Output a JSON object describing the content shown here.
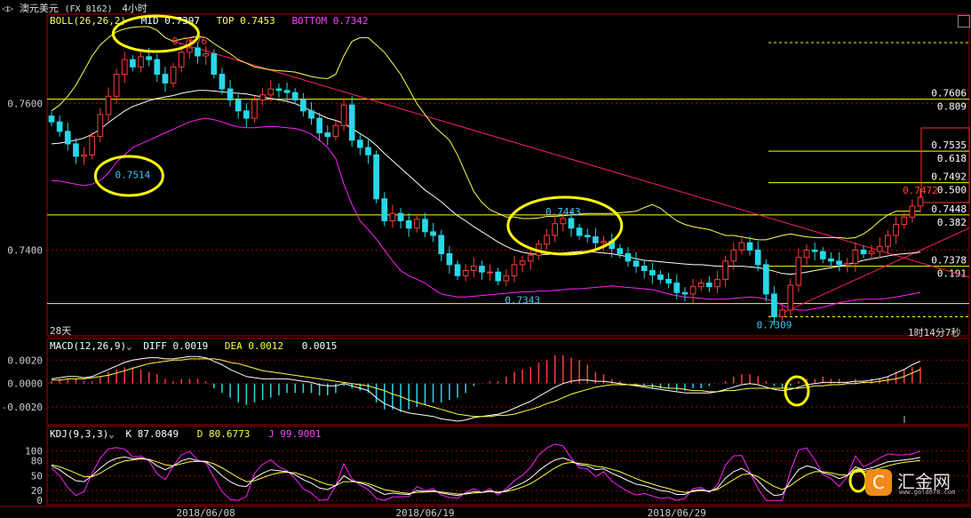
{
  "window": {
    "symbol_label": "澳元美元",
    "code_label": "(FX 8162)",
    "period_label": "4小时"
  },
  "boll": {
    "label": "BOLL(26,26,2)",
    "mid": "MID 0.7397",
    "top": "TOP 0.7453",
    "bottom": "BOTTOM 0.7342"
  },
  "macd": {
    "label": "MACD(12,26,9)",
    "diff": "DIFF 0.0019",
    "dea": "DEA 0.0012",
    "macd": "0.0015"
  },
  "kdj": {
    "label": "KDJ(9,3,3)",
    "k": "K 87.0849",
    "d": "D 80.6773",
    "j": "J 99.9001"
  },
  "footer": {
    "period_note": "28天",
    "countdown": "1时14分7秒"
  },
  "colors": {
    "up": "#ff3c3c",
    "down": "#28d8e8",
    "boll_mid": "#ffffff",
    "boll_top": "#ffff50",
    "boll_bottom": "#ff20ff",
    "fib": "#ffff00",
    "trend": "#ff2060",
    "dif": "#ffffff",
    "dea": "#ffff40",
    "k": "#ffffff",
    "d": "#ffff40",
    "j": "#ff20ff"
  },
  "chart_data": [
    {
      "type": "candlestick",
      "panel": "price",
      "ylim": [
        0.7295,
        0.7705
      ],
      "y_ticks": [
        "0.7600",
        "0.7400"
      ],
      "x_ticks": [
        "2018/06/08",
        "2018/06/19",
        "2018/06/29"
      ],
      "close": [
        0.7575,
        0.7562,
        0.7545,
        0.7528,
        0.753,
        0.7555,
        0.7585,
        0.761,
        0.764,
        0.766,
        0.765,
        0.7664,
        0.766,
        0.764,
        0.7628,
        0.765,
        0.767,
        0.7676,
        0.7665,
        0.7668,
        0.764,
        0.762,
        0.7605,
        0.759,
        0.758,
        0.7605,
        0.7612,
        0.762,
        0.7618,
        0.7615,
        0.7605,
        0.759,
        0.758,
        0.756,
        0.7555,
        0.757,
        0.7598,
        0.755,
        0.754,
        0.753,
        0.747,
        0.744,
        0.745,
        0.744,
        0.743,
        0.7442,
        0.7425,
        0.742,
        0.7395,
        0.738,
        0.7365,
        0.7372,
        0.7378,
        0.737,
        0.737,
        0.7358,
        0.7365,
        0.738,
        0.7385,
        0.7393,
        0.7408,
        0.742,
        0.7436,
        0.7443,
        0.743,
        0.742,
        0.7418,
        0.741,
        0.7412,
        0.7402,
        0.7395,
        0.7385,
        0.7378,
        0.7372,
        0.7366,
        0.736,
        0.7355,
        0.7342,
        0.734,
        0.735,
        0.7355,
        0.735,
        0.736,
        0.7385,
        0.74,
        0.741,
        0.74,
        0.738,
        0.734,
        0.7309,
        0.7318,
        0.7352,
        0.739,
        0.74,
        0.7398,
        0.7388,
        0.7385,
        0.738,
        0.7382,
        0.74,
        0.7395,
        0.7398,
        0.7405,
        0.742,
        0.7435,
        0.7445,
        0.746,
        0.7472
      ],
      "mid": [
        0.7545,
        0.7546,
        0.7548,
        0.755,
        0.7553,
        0.7558,
        0.7565,
        0.7574,
        0.7582,
        0.759,
        0.7596,
        0.76,
        0.7604,
        0.7607,
        0.7609,
        0.7611,
        0.7614,
        0.7616,
        0.7618,
        0.7618,
        0.7617,
        0.7616,
        0.7615,
        0.7614,
        0.7613,
        0.7611,
        0.7609,
        0.7607,
        0.7605,
        0.7603,
        0.76,
        0.7595,
        0.759,
        0.7585,
        0.758,
        0.7577,
        0.7573,
        0.7566,
        0.7559,
        0.7552,
        0.7543,
        0.7532,
        0.7522,
        0.7512,
        0.7502,
        0.7492,
        0.7482,
        0.7474,
        0.7466,
        0.7456,
        0.7447,
        0.744,
        0.7432,
        0.7425,
        0.7418,
        0.7411,
        0.7405,
        0.74,
        0.7397,
        0.7395,
        0.7394,
        0.7394,
        0.7395,
        0.7396,
        0.7397,
        0.7398,
        0.7398,
        0.7397,
        0.7396,
        0.7395,
        0.7393,
        0.7391,
        0.7388,
        0.7386,
        0.7385,
        0.7384,
        0.7383,
        0.7382,
        0.7381,
        0.738,
        0.738,
        0.7379,
        0.7378,
        0.7378,
        0.7378,
        0.7378,
        0.7377,
        0.7376,
        0.7374,
        0.7371,
        0.7368,
        0.7367,
        0.7368,
        0.737,
        0.7372,
        0.7374,
        0.7376,
        0.7378,
        0.738,
        0.7383,
        0.7386,
        0.7388,
        0.739,
        0.7392,
        0.7394,
        0.7395,
        0.7396,
        0.7397
      ],
      "top": [
        0.759,
        0.7598,
        0.761,
        0.7625,
        0.7645,
        0.7665,
        0.768,
        0.769,
        0.7698,
        0.7702,
        0.7704,
        0.7705,
        0.7705,
        0.77,
        0.769,
        0.7685,
        0.7688,
        0.769,
        0.7692,
        0.769,
        0.7682,
        0.7675,
        0.7668,
        0.766,
        0.7655,
        0.765,
        0.7648,
        0.7646,
        0.7645,
        0.7644,
        0.7643,
        0.764,
        0.7637,
        0.7635,
        0.7634,
        0.764,
        0.7665,
        0.7685,
        0.769,
        0.769,
        0.768,
        0.767,
        0.7655,
        0.764,
        0.762,
        0.76,
        0.7585,
        0.757,
        0.756,
        0.755,
        0.753,
        0.7505,
        0.748,
        0.7465,
        0.7455,
        0.745,
        0.7445,
        0.7445,
        0.7443,
        0.7443,
        0.7444,
        0.7446,
        0.7446,
        0.7447,
        0.7448,
        0.7449,
        0.745,
        0.745,
        0.745,
        0.745,
        0.7451,
        0.7452,
        0.7453,
        0.7458,
        0.7462,
        0.7457,
        0.7448,
        0.744,
        0.7435,
        0.7432,
        0.743,
        0.7428,
        0.7424,
        0.742,
        0.742,
        0.7418,
        0.7416,
        0.7414,
        0.7414,
        0.7417,
        0.742,
        0.7422,
        0.742,
        0.7418,
        0.7417,
        0.7417,
        0.7417,
        0.7417,
        0.7416,
        0.7417,
        0.7422,
        0.743,
        0.744,
        0.7448,
        0.7453,
        0.7453,
        0.7453,
        0.7453
      ],
      "bottom": [
        0.7495,
        0.7494,
        0.7492,
        0.749,
        0.7488,
        0.749,
        0.7495,
        0.7505,
        0.752,
        0.753,
        0.754,
        0.7545,
        0.755,
        0.7555,
        0.756,
        0.7565,
        0.757,
        0.7575,
        0.7578,
        0.758,
        0.7578,
        0.7575,
        0.7571,
        0.7568,
        0.7567,
        0.7567,
        0.7568,
        0.7569,
        0.7568,
        0.7567,
        0.7566,
        0.7563,
        0.7558,
        0.755,
        0.754,
        0.7525,
        0.749,
        0.7462,
        0.744,
        0.7428,
        0.7415,
        0.74,
        0.7385,
        0.7372,
        0.7365,
        0.736,
        0.7355,
        0.7347,
        0.734,
        0.7338,
        0.7336,
        0.7336,
        0.7337,
        0.7338,
        0.7339,
        0.734,
        0.7341,
        0.7342,
        0.7343,
        0.7343,
        0.7344,
        0.7344,
        0.7345,
        0.7346,
        0.7347,
        0.7347,
        0.7348,
        0.7349,
        0.735,
        0.7351,
        0.735,
        0.7349,
        0.7348,
        0.7347,
        0.7346,
        0.7343,
        0.734,
        0.7338,
        0.7336,
        0.7335,
        0.7334,
        0.7333,
        0.7333,
        0.7333,
        0.7334,
        0.7335,
        0.7336,
        0.7335,
        0.7333,
        0.733,
        0.7325,
        0.732,
        0.7318,
        0.7318,
        0.732,
        0.7322,
        0.7325,
        0.7328,
        0.733,
        0.7332,
        0.7333,
        0.7333,
        0.7333,
        0.7334,
        0.7336,
        0.7338,
        0.734,
        0.7342
      ],
      "fib_levels": [
        {
          "price": 0.7606,
          "label": "0.7606",
          "fib": "0.809"
        },
        {
          "price": 0.7535,
          "label": "0.7535",
          "fib": "0.618"
        },
        {
          "price": 0.7492,
          "label": "0.7492",
          "fib": "0.500"
        },
        {
          "price": 0.7448,
          "label": "0.7448",
          "fib": "0.382"
        },
        {
          "price": 0.7378,
          "label": "0.7378",
          "fib": "0.191"
        }
      ],
      "annotations": [
        {
          "text": "0.7676",
          "price": 0.7676,
          "index": 17
        },
        {
          "text": "0.7514",
          "price": 0.7514,
          "index": 10
        },
        {
          "text": "0.7343",
          "price": 0.7343,
          "index": 58
        },
        {
          "text": "0.7443",
          "price": 0.7443,
          "index": 63
        },
        {
          "text": "0.7309",
          "price": 0.7309,
          "index": 89
        },
        {
          "text": "0.7472",
          "price": 0.7472,
          "index": 107
        }
      ]
    },
    {
      "type": "macd",
      "panel": "macd",
      "ylim": [
        -0.0032,
        0.0027
      ],
      "y_ticks": [
        "0.0020",
        "0.0000",
        "-0.0020"
      ],
      "diff": [
        0.0004,
        0.0005,
        0.0006,
        0.0006,
        0.0005,
        0.0006,
        0.0009,
        0.0012,
        0.0015,
        0.0018,
        0.002,
        0.0021,
        0.0022,
        0.0022,
        0.0021,
        0.0021,
        0.0022,
        0.0023,
        0.0023,
        0.0022,
        0.0019,
        0.0016,
        0.0012,
        0.0009,
        0.0006,
        0.0005,
        0.0004,
        0.0004,
        0.0004,
        0.0004,
        0.0003,
        0.0002,
        0.0001,
        -0.0001,
        -0.0002,
        -0.0002,
        0.0,
        -0.0002,
        -0.0004,
        -0.0006,
        -0.0012,
        -0.0017,
        -0.002,
        -0.0023,
        -0.0025,
        -0.0026,
        -0.0027,
        -0.0028,
        -0.003,
        -0.0031,
        -0.0032,
        -0.0031,
        -0.0029,
        -0.0028,
        -0.0027,
        -0.0026,
        -0.0024,
        -0.0021,
        -0.0018,
        -0.0015,
        -0.0011,
        -0.0007,
        -0.0003,
        0.0,
        0.0002,
        0.0003,
        0.0003,
        0.0002,
        0.0002,
        0.0001,
        0.0,
        -0.0001,
        -0.0002,
        -0.0003,
        -0.0004,
        -0.0005,
        -0.0006,
        -0.0007,
        -0.0008,
        -0.0008,
        -0.0008,
        -0.0008,
        -0.0007,
        -0.0005,
        -0.0003,
        -0.0001,
        0.0,
        -0.0001,
        -0.0003,
        -0.0005,
        -0.0006,
        -0.0005,
        -0.0003,
        -0.0001,
        0.0,
        0.0001,
        0.0001,
        0.0001,
        0.0001,
        0.0002,
        0.0002,
        0.0003,
        0.0004,
        0.0006,
        0.0009,
        0.0012,
        0.0016,
        0.0019
      ],
      "dea": [
        0.0003,
        0.0003,
        0.0004,
        0.0004,
        0.0004,
        0.0005,
        0.0006,
        0.0007,
        0.0009,
        0.0011,
        0.0013,
        0.0015,
        0.0017,
        0.0018,
        0.0019,
        0.002,
        0.002,
        0.0021,
        0.0021,
        0.0021,
        0.0021,
        0.002,
        0.0018,
        0.0017,
        0.0015,
        0.0013,
        0.0011,
        0.001,
        0.0009,
        0.0008,
        0.0007,
        0.0006,
        0.0005,
        0.0004,
        0.0003,
        0.0002,
        0.0001,
        0.0,
        -0.0001,
        -0.0002,
        -0.0004,
        -0.0006,
        -0.0009,
        -0.0011,
        -0.0014,
        -0.0016,
        -0.0018,
        -0.002,
        -0.0022,
        -0.0024,
        -0.0026,
        -0.0027,
        -0.0028,
        -0.0028,
        -0.0028,
        -0.0027,
        -0.0027,
        -0.0026,
        -0.0024,
        -0.0022,
        -0.002,
        -0.0017,
        -0.0015,
        -0.0012,
        -0.0009,
        -0.0007,
        -0.0005,
        -0.0003,
        -0.0002,
        -0.0001,
        -0.0001,
        -0.0001,
        -0.0001,
        -0.0002,
        -0.0002,
        -0.0003,
        -0.0004,
        -0.0004,
        -0.0005,
        -0.0006,
        -0.0006,
        -0.0007,
        -0.0007,
        -0.0006,
        -0.0006,
        -0.0005,
        -0.0004,
        -0.0004,
        -0.0004,
        -0.0004,
        -0.0004,
        -0.0004,
        -0.0004,
        -0.0003,
        -0.0002,
        -0.0002,
        -0.0001,
        -0.0001,
        0.0,
        0.0,
        0.0001,
        0.0001,
        0.0002,
        0.0003,
        0.0004,
        0.0006,
        0.0009,
        0.0012
      ]
    },
    {
      "type": "kdj",
      "panel": "kdj",
      "ylim": [
        -5,
        110
      ],
      "y_ticks": [
        "100",
        "80",
        "50",
        "20",
        "0"
      ],
      "k": [
        70,
        62,
        50,
        40,
        38,
        50,
        65,
        78,
        85,
        88,
        84,
        86,
        82,
        70,
        62,
        70,
        80,
        85,
        80,
        78,
        65,
        50,
        38,
        30,
        28,
        45,
        55,
        62,
        60,
        58,
        52,
        42,
        35,
        25,
        22,
        30,
        50,
        40,
        35,
        30,
        20,
        12,
        15,
        13,
        12,
        20,
        18,
        20,
        15,
        12,
        10,
        14,
        18,
        16,
        20,
        15,
        20,
        28,
        35,
        45,
        60,
        72,
        82,
        86,
        80,
        72,
        70,
        62,
        64,
        55,
        48,
        40,
        33,
        30,
        25,
        20,
        18,
        12,
        12,
        20,
        22,
        18,
        25,
        45,
        58,
        65,
        55,
        40,
        22,
        10,
        12,
        40,
        62,
        70,
        66,
        56,
        52,
        44,
        50,
        68,
        62,
        66,
        72,
        78,
        80,
        82,
        84,
        87
      ],
      "d": [
        72,
        68,
        62,
        55,
        48,
        48,
        55,
        65,
        74,
        80,
        82,
        84,
        83,
        78,
        72,
        70,
        74,
        78,
        79,
        79,
        74,
        66,
        56,
        46,
        38,
        40,
        46,
        52,
        56,
        57,
        56,
        51,
        45,
        38,
        32,
        30,
        38,
        38,
        37,
        34,
        28,
        22,
        19,
        16,
        14,
        16,
        17,
        18,
        17,
        15,
        13,
        13,
        15,
        16,
        18,
        17,
        18,
        22,
        27,
        34,
        44,
        55,
        66,
        74,
        77,
        75,
        73,
        69,
        67,
        63,
        58,
        51,
        44,
        38,
        33,
        28,
        24,
        19,
        16,
        18,
        20,
        19,
        22,
        32,
        42,
        52,
        54,
        48,
        38,
        28,
        22,
        30,
        42,
        52,
        58,
        58,
        56,
        52,
        51,
        57,
        59,
        61,
        65,
        70,
        74,
        77,
        79,
        80.7
      ],
      "j": [
        65,
        50,
        26,
        10,
        18,
        55,
        85,
        104,
        107,
        104,
        88,
        90,
        80,
        54,
        42,
        70,
        92,
        99,
        82,
        76,
        47,
        18,
        2,
        0,
        8,
        55,
        73,
        82,
        68,
        60,
        44,
        24,
        15,
        0,
        2,
        30,
        74,
        44,
        31,
        22,
        4,
        0,
        7,
        7,
        8,
        28,
        20,
        24,
        11,
        6,
        4,
        16,
        24,
        16,
        24,
        11,
        24,
        40,
        51,
        67,
        92,
        106,
        114,
        110,
        86,
        66,
        64,
        48,
        58,
        39,
        28,
        18,
        11,
        14,
        9,
        4,
        6,
        0,
        4,
        24,
        26,
        16,
        31,
        71,
        90,
        91,
        57,
        24,
        0,
        0,
        0,
        60,
        102,
        106,
        82,
        52,
        44,
        28,
        48,
        90,
        68,
        76,
        86,
        94,
        92,
        92,
        94,
        99.9
      ]
    }
  ]
}
